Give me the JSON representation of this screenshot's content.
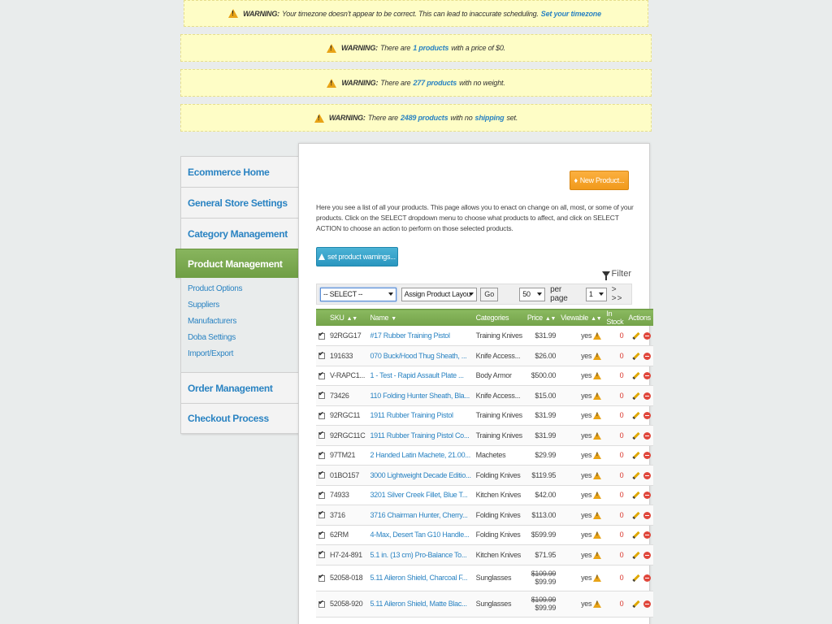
{
  "warnings": [
    {
      "label": "WARNING:",
      "pre": "Your timezone doesn't appear to be correct. This can lead to inaccurate scheduling.",
      "link": "Set your timezone",
      "post": ""
    },
    {
      "label": "WARNING:",
      "pre": "There are",
      "link": "1 products",
      "post": "with a price of $0."
    },
    {
      "label": "WARNING:",
      "pre": "There are",
      "link": "277 products",
      "post": "with no weight."
    },
    {
      "label": "WARNING:",
      "pre": "There are",
      "link": "2489 products",
      "post": "with no",
      "link2": "shipping",
      "post2": "set."
    }
  ],
  "sidebar": {
    "items": [
      "Ecommerce Home",
      "General Store Settings",
      "Category Management",
      "Product Management",
      "Order Management",
      "Checkout Process"
    ],
    "subitems": [
      "Product Options",
      "Suppliers",
      "Manufacturers",
      "Doba Settings",
      "Import/Export"
    ]
  },
  "main": {
    "new_button": "New Product...",
    "intro": "Here you see a list of all your products. This page allows you to enact on change on all, most, or some of your products. Click on the SELECT dropdown menu to choose what products to affect, and click on SELECT ACTION to choose an action to perform on those selected products.",
    "warnings_button": "set product warnings...",
    "filter_label": "Filter",
    "toolbar": {
      "select_value": "-- SELECT --",
      "action_value": "Assign Product Layou",
      "go_label": "Go",
      "perpage_value": "50",
      "perpage_label": "per page",
      "page_value": "1",
      "pager_label": "> >>"
    },
    "columns": [
      "SKU",
      "Name",
      "Categories",
      "Price",
      "Viewable",
      "In Stock",
      "Actions"
    ],
    "rows": [
      {
        "sku": "92RGG17",
        "name": "#17 Rubber Training Pistol",
        "cat": "Training Knives",
        "price": "$31.99",
        "old": "",
        "view": "yes",
        "stock": "0"
      },
      {
        "sku": "191633",
        "name": "070 Buck/Hood Thug Sheath, ...",
        "cat": "Knife Access...",
        "price": "$26.00",
        "old": "",
        "view": "yes",
        "stock": "0"
      },
      {
        "sku": "V-RAPC1...",
        "name": "1 - Test - Rapid Assault Plate ...",
        "cat": "Body Armor",
        "price": "$500.00",
        "old": "",
        "view": "yes",
        "stock": "0"
      },
      {
        "sku": "73426",
        "name": "110 Folding Hunter Sheath, Bla...",
        "cat": "Knife Access...",
        "price": "$15.00",
        "old": "",
        "view": "yes",
        "stock": "0"
      },
      {
        "sku": "92RGC11",
        "name": "1911 Rubber Training Pistol",
        "cat": "Training Knives",
        "price": "$31.99",
        "old": "",
        "view": "yes",
        "stock": "0"
      },
      {
        "sku": "92RGC11C",
        "name": "1911 Rubber Training Pistol Co...",
        "cat": "Training Knives",
        "price": "$31.99",
        "old": "",
        "view": "yes",
        "stock": "0"
      },
      {
        "sku": "97TM21",
        "name": "2 Handed Latin Machete, 21.00...",
        "cat": "Machetes",
        "price": "$29.99",
        "old": "",
        "view": "yes",
        "stock": "0"
      },
      {
        "sku": "01BO157",
        "name": "3000 Lightweight Decade Editio...",
        "cat": "Folding Knives",
        "price": "$119.95",
        "old": "",
        "view": "yes",
        "stock": "0"
      },
      {
        "sku": "74933",
        "name": "3201 Silver Creek Fillet, Blue T...",
        "cat": "Kitchen Knives",
        "price": "$42.00",
        "old": "",
        "view": "yes",
        "stock": "0"
      },
      {
        "sku": "3716",
        "name": "3716 Chairman Hunter, Cherry...",
        "cat": "Folding Knives",
        "price": "$113.00",
        "old": "",
        "view": "yes",
        "stock": "0"
      },
      {
        "sku": "62RM",
        "name": "4-Max, Desert Tan G10 Handle...",
        "cat": "Folding Knives",
        "price": "$599.99",
        "old": "",
        "view": "yes",
        "stock": "0"
      },
      {
        "sku": "H7-24-891",
        "name": "5.1 in. (13 cm) Pro-Balance To...",
        "cat": "Kitchen Knives",
        "price": "$71.95",
        "old": "",
        "view": "yes",
        "stock": "0"
      },
      {
        "sku": "52058-018",
        "name": "5.11 Aileron Shield, Charcoal F...",
        "cat": "Sunglasses",
        "price": "$99.99",
        "old": "$109.99",
        "view": "yes",
        "stock": "0"
      },
      {
        "sku": "52058-920",
        "name": "5.11 Aileron Shield, Matte Blac...",
        "cat": "Sunglasses",
        "price": "$99.99",
        "old": "$109.99",
        "view": "yes",
        "stock": "0"
      }
    ]
  }
}
